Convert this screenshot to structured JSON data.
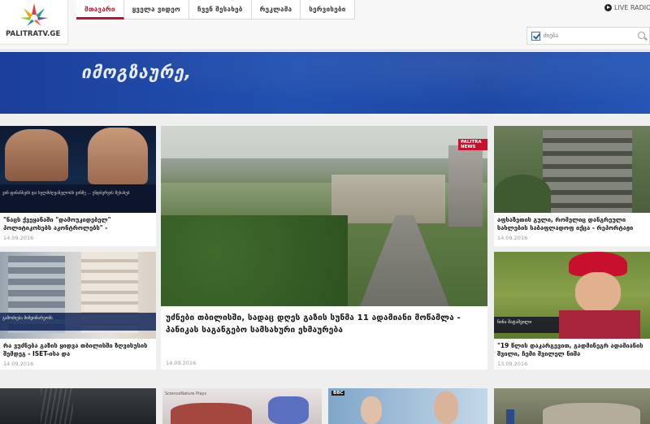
{
  "site": {
    "logo_text": "PALITRATV.GE"
  },
  "nav": {
    "items": [
      {
        "label": "მთავარი",
        "active": true
      },
      {
        "label": "ყველა ვიდეო",
        "active": false
      },
      {
        "label": "ჩვენ შესახებ",
        "active": false
      },
      {
        "label": "რეკლამა",
        "active": false
      },
      {
        "label": "სერვისები",
        "active": false
      }
    ]
  },
  "live": {
    "label": "LIVE RADIO"
  },
  "search": {
    "placeholder": "ძიება",
    "value": ""
  },
  "banner": {
    "text": "იმოგზაურე,"
  },
  "feature": {
    "title": "უძნები თბილისში, სადაც დღეს გაზის სუნმა 11 ადამიანი მოწამლა - პანიკას საგანგებო სამსახური ეხმაურება",
    "date": "14.09.2016",
    "thumb_badge": "PALITRA NEWS"
  },
  "left_cards": [
    {
      "title": "\"ნაცს ქვეყანაში \"დამოუკიდებელ\" პოლიტიკოსებს აკონტროლებს\" -",
      "date": "14.09.2016",
      "caption": "ვინ ფინანსებს და ხელმძღვანელობს ვინმე ... ენდბერვის შესახებ"
    },
    {
      "title": "რა ვუძნება გაზის ყიდვა თბილისში ზღვისუსის შემდეგ - ISET-ისა და",
      "date": "14.09.2016",
      "caption": "გამოძიება მიმდინარეობს"
    }
  ],
  "right_cards": [
    {
      "title": "აფხაზეთის გული, რომელიც დანგრეული სახლების საბაფლადოფ იქცა - რეპორტაჟი",
      "date": "14.09.2016"
    },
    {
      "title": "\"19 წლის დაკარგევით, გადმინეგრ ადამიანის შვილი, ჩემი შვილელ ნიშა",
      "date": "13.09.2016",
      "caption": "ნინა შატაშვილი"
    }
  ],
  "bottom_cards": [
    {
      "label": ""
    },
    {
      "label": "ScienceNature Plays"
    },
    {
      "label": "BBC"
    },
    {
      "label": ""
    }
  ]
}
